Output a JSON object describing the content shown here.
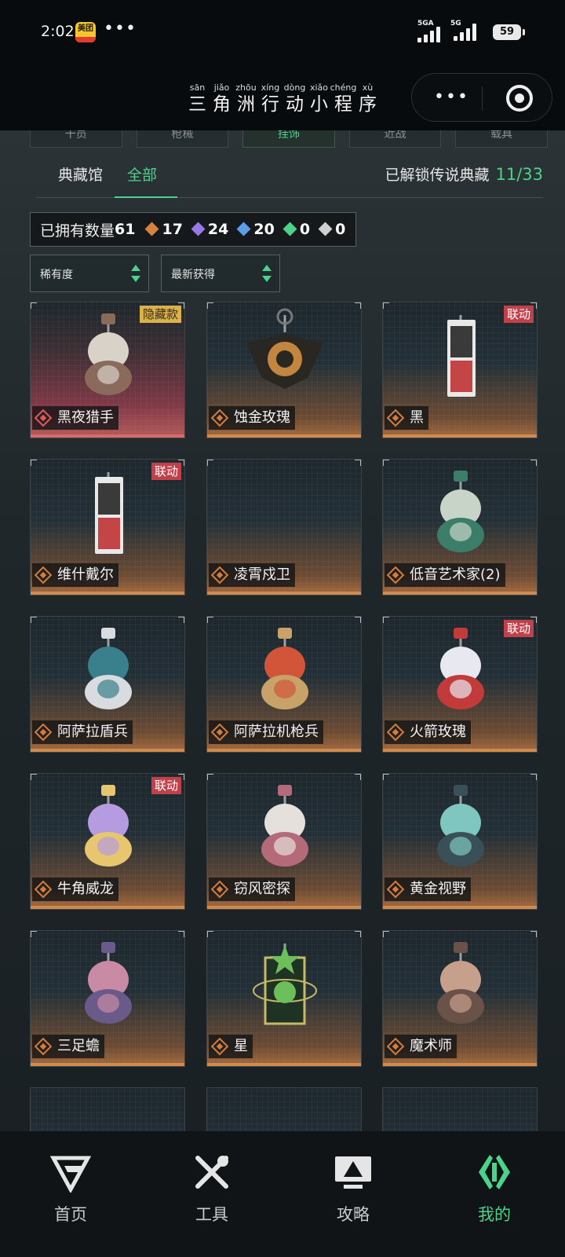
{
  "status_bar": {
    "time": "2:02",
    "app_badge": "美团",
    "more": "•••",
    "signal1_label": "5GA",
    "signal2_label": "5G",
    "battery": "59"
  },
  "header": {
    "title_chars": [
      {
        "py": "sān",
        "hz": "三"
      },
      {
        "py": "jiǎo",
        "hz": "角"
      },
      {
        "py": "zhōu",
        "hz": "洲"
      },
      {
        "py": "xíng",
        "hz": "行"
      },
      {
        "py": "dòng",
        "hz": "动"
      },
      {
        "py": "xiǎo",
        "hz": "小"
      },
      {
        "py": "chéng",
        "hz": "程"
      },
      {
        "py": "xù",
        "hz": "序"
      }
    ],
    "capsule_more": "•••"
  },
  "category_tabs": [
    {
      "label": "干员",
      "active": false
    },
    {
      "label": "枪械",
      "active": false
    },
    {
      "label": "挂饰",
      "active": true
    },
    {
      "label": "近战",
      "active": false
    },
    {
      "label": "载具",
      "active": false
    }
  ],
  "subtabs": {
    "collection": "典藏馆",
    "all": "全部",
    "unlock_label": "已解锁传说典藏",
    "unlock_count": "11/33"
  },
  "owned": {
    "label": "已拥有数量",
    "total": "61",
    "stats": [
      {
        "value": "17",
        "color": "#d9823f"
      },
      {
        "value": "24",
        "color": "#9a78e6"
      },
      {
        "value": "20",
        "color": "#5c9fe8"
      },
      {
        "value": "0",
        "color": "#4bd38a"
      },
      {
        "value": "0",
        "color": "#cfcfcf"
      }
    ]
  },
  "filters": {
    "rarity": "稀有度",
    "sort": "最新获得"
  },
  "items": [
    {
      "name": "黑夜猎手",
      "tag": "隐藏款",
      "tag_style": "gold",
      "rarity": "red",
      "icon": "skull-hunter-charm"
    },
    {
      "name": "蚀金玫瑰",
      "tag": "",
      "tag_style": "",
      "rarity": "gold",
      "icon": "black-rose-charm"
    },
    {
      "name": "黑",
      "tag": "联动",
      "tag_style": "red",
      "rarity": "gold",
      "icon": "card-charm"
    },
    {
      "name": "维什戴尔",
      "tag": "联动",
      "tag_style": "red",
      "rarity": "gold",
      "icon": "card-charm"
    },
    {
      "name": "凌霄戍卫",
      "tag": "",
      "tag_style": "",
      "rarity": "gold",
      "icon": "empty-charm"
    },
    {
      "name": "低音艺术家(2)",
      "tag": "",
      "tag_style": "",
      "rarity": "gold",
      "icon": "musician-charm"
    },
    {
      "name": "阿萨拉盾兵",
      "tag": "",
      "tag_style": "",
      "rarity": "gold",
      "icon": "shield-soldier-charm"
    },
    {
      "name": "阿萨拉机枪兵",
      "tag": "",
      "tag_style": "",
      "rarity": "gold",
      "icon": "gunner-charm"
    },
    {
      "name": "火箭玫瑰",
      "tag": "联动",
      "tag_style": "red",
      "rarity": "gold",
      "icon": "rocket-charm"
    },
    {
      "name": "牛角威龙",
      "tag": "联动",
      "tag_style": "red",
      "rarity": "gold",
      "icon": "horned-dragon-charm"
    },
    {
      "name": "窃风密探",
      "tag": "",
      "tag_style": "",
      "rarity": "gold",
      "icon": "rabbit-spy-charm"
    },
    {
      "name": "黄金视野",
      "tag": "",
      "tag_style": "",
      "rarity": "gold",
      "icon": "golden-vision-charm"
    },
    {
      "name": "三足蟾",
      "tag": "",
      "tag_style": "",
      "rarity": "gold",
      "icon": "toad-charm"
    },
    {
      "name": "星",
      "tag": "",
      "tag_style": "",
      "rarity": "gold",
      "icon": "star-frame-charm"
    },
    {
      "name": "魔术师",
      "tag": "",
      "tag_style": "",
      "rarity": "gold",
      "icon": "magician-charm"
    }
  ],
  "bottom_nav": [
    {
      "label": "首页",
      "icon": "home-logo-icon",
      "active": false
    },
    {
      "label": "工具",
      "icon": "tools-icon",
      "active": false
    },
    {
      "label": "攻略",
      "icon": "guide-monitor-icon",
      "active": false
    },
    {
      "label": "我的",
      "icon": "profile-logo-icon",
      "active": true
    }
  ]
}
